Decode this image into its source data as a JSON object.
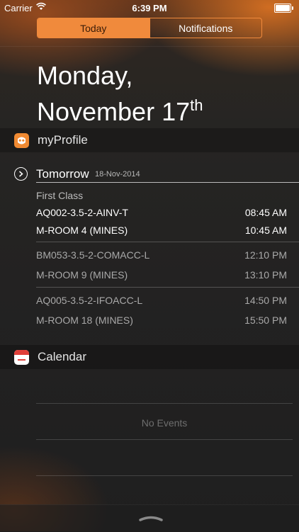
{
  "status_bar": {
    "carrier": "Carrier",
    "time": "6:39 PM",
    "battery_level": 1.0
  },
  "tabs": [
    {
      "label": "Today",
      "active": true
    },
    {
      "label": "Notifications",
      "active": false
    }
  ],
  "date": {
    "line1": "Monday,",
    "line2": "November 17",
    "suffix": "th"
  },
  "profile_widget": {
    "app_name": "myProfile",
    "icon": "myprofile-app-icon",
    "accent": "#f08a32",
    "section_title": "Tomorrow",
    "section_date": "18-Nov-2014",
    "subtitle": "First Class",
    "classes": [
      {
        "code": "AQ002-3.5-2-AINV-T",
        "start": "08:45 AM",
        "room": "M-ROOM 4 (MINES)",
        "end": "10:45 AM",
        "highlight": true
      },
      {
        "code": "BM053-3.5-2-COMACC-L",
        "start": "12:10 PM",
        "room": "M-ROOM 9 (MINES)",
        "end": "13:10 PM",
        "highlight": false
      },
      {
        "code": "AQ005-3.5-2-IFOACC-L",
        "start": "14:50 PM",
        "room": "M-ROOM 18 (MINES)",
        "end": "15:50 PM",
        "highlight": false
      }
    ]
  },
  "calendar_widget": {
    "app_name": "Calendar",
    "icon": "calendar-app-icon",
    "empty_text": "No Events"
  },
  "colors": {
    "accent": "#f08a3c",
    "calendar_red": "#e0403a"
  }
}
